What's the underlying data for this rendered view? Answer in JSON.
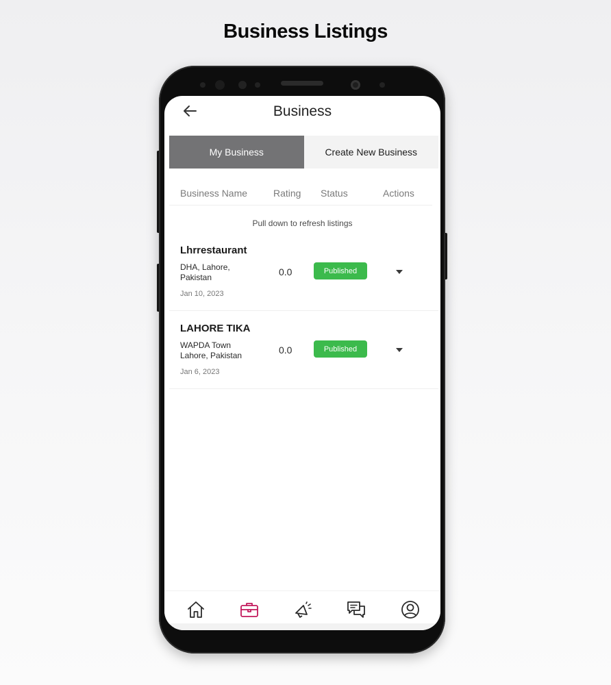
{
  "page": {
    "heading": "Business Listings"
  },
  "header": {
    "title": "Business",
    "back_icon": "arrow-left-icon"
  },
  "tabs": [
    {
      "label": "My Business",
      "active": true
    },
    {
      "label": "Create New Business",
      "active": false
    }
  ],
  "table": {
    "columns": [
      "Business Name",
      "Rating",
      "Status",
      "Actions"
    ],
    "refresh_hint": "Pull down to refresh listings",
    "rows": [
      {
        "name": "Lhrrestaurant",
        "address": "DHA, Lahore, Pakistan",
        "date": "Jan 10, 2023",
        "rating": "0.0",
        "status": "Published"
      },
      {
        "name": "LAHORE TIKA",
        "address": "WAPDA Town Lahore, Pakistan",
        "date": "Jan 6, 2023",
        "rating": "0.0",
        "status": "Published"
      }
    ]
  },
  "bottom_nav": [
    {
      "icon": "home-icon",
      "active": false
    },
    {
      "icon": "briefcase-icon",
      "active": true
    },
    {
      "icon": "megaphone-icon",
      "active": false
    },
    {
      "icon": "chat-icon",
      "active": false
    },
    {
      "icon": "profile-icon",
      "active": false
    }
  ],
  "colors": {
    "active_tab": "#737375",
    "published_badge": "#3cba4c",
    "nav_active": "#c2185b",
    "nav_inactive": "#2b2b2b"
  }
}
